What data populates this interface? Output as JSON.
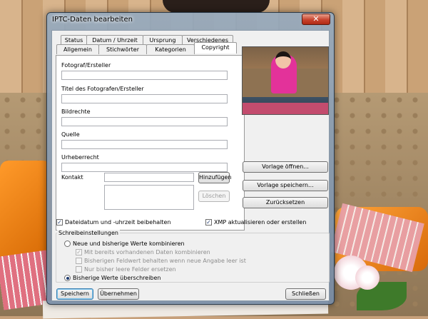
{
  "window": {
    "title": "IPTC-Daten bearbeiten",
    "close_glyph": "✕"
  },
  "tabs": {
    "row_back": [
      "Status",
      "Datum / Uhrzeit",
      "Ursprung",
      "Verschiedenes"
    ],
    "row_front": [
      "Allgemein",
      "Stichwörter",
      "Kategorien",
      "Copyright"
    ],
    "active": "Copyright"
  },
  "copyright": {
    "fotograf_label": "Fotograf/Ersteller",
    "fotograf_value": "",
    "titel_label": "Titel des Fotografen/Ersteller",
    "titel_value": "",
    "bildrechte_label": "Bildrechte",
    "bildrechte_value": "",
    "quelle_label": "Quelle",
    "quelle_value": "",
    "urheberrecht_label": "Urheberrecht",
    "urheberrecht_value": "",
    "kontakt_label": "Kontakt",
    "kontakt_value": "",
    "hinzufuegen_label": "Hinzufügen",
    "loeschen_label": "Löschen"
  },
  "template_buttons": {
    "open": "Vorlage öffnen...",
    "save": "Vorlage speichern...",
    "reset": "Zurücksetzen"
  },
  "options": {
    "keep_date_label": "Dateidatum und -uhrzeit beibehalten",
    "keep_date_checked": true,
    "xmp_label": "XMP aktualisieren oder erstellen",
    "xmp_checked": true
  },
  "save_settings": {
    "group_label": "Schreibeinstellungen",
    "combine_label": "Neue und bisherige Werte kombinieren",
    "combine_selected": false,
    "sub_existing_label": "Mit bereits vorhandenen Daten kombinieren",
    "sub_existing_checked": true,
    "sub_keep_label": "Bisherigen Feldwert behalten wenn neue Angabe leer ist",
    "sub_keep_checked": false,
    "sub_replace_label": "Nur bisher leere Felder ersetzen",
    "sub_replace_checked": false,
    "overwrite_label": "Bisherige Werte überschreiben",
    "overwrite_selected": true
  },
  "footer": {
    "save": "Speichern",
    "apply": "Übernehmen",
    "close": "Schließen"
  },
  "checkmark_glyph": "✓"
}
